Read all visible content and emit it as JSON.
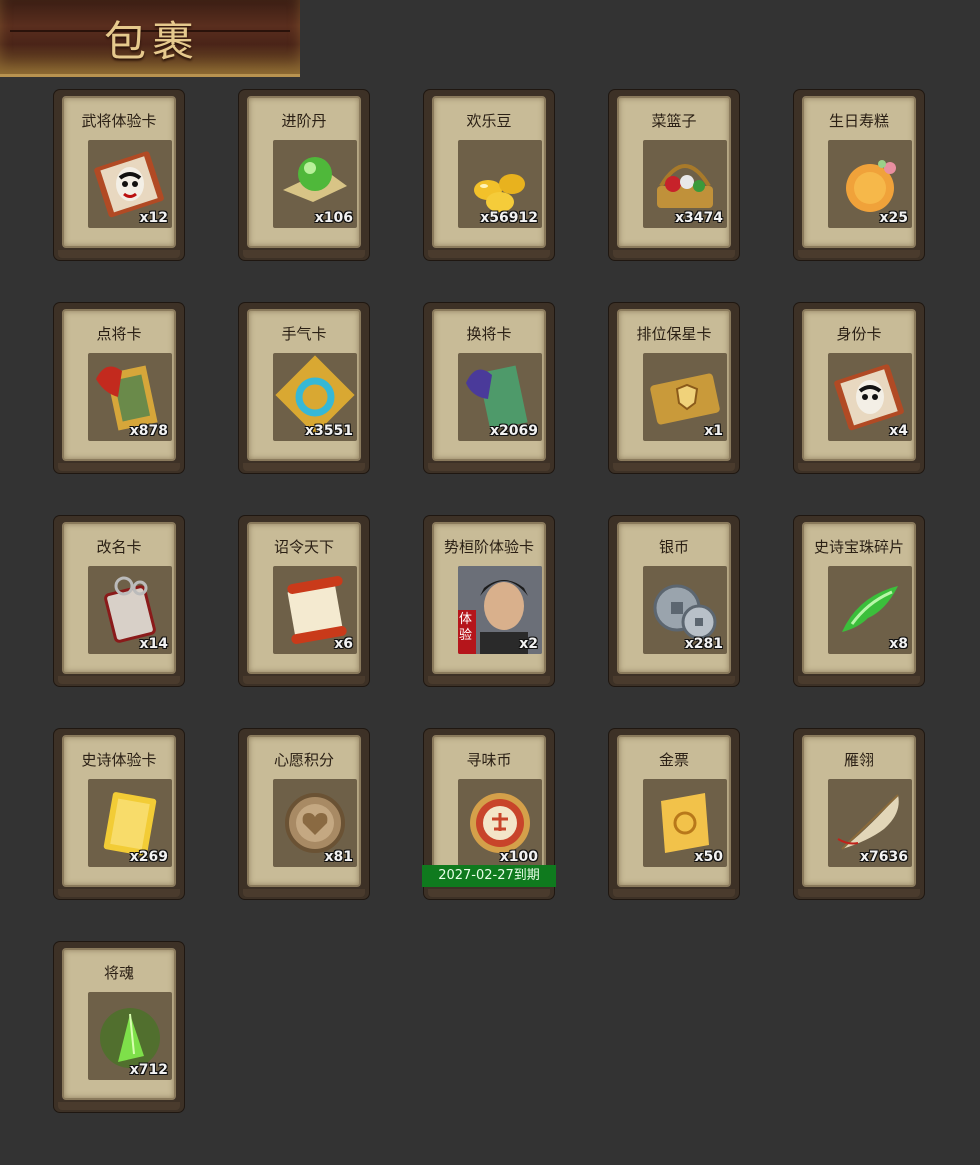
{
  "header": {
    "title": "包裹"
  },
  "items": [
    {
      "name": "武将体验卡",
      "qty": "x12",
      "icon": "opera-mask-card-icon"
    },
    {
      "name": "进阶丹",
      "qty": "x106",
      "icon": "green-pill-icon"
    },
    {
      "name": "欢乐豆",
      "qty": "x56912",
      "icon": "gold-beans-icon"
    },
    {
      "name": "菜篮子",
      "qty": "x3474",
      "icon": "basket-icon"
    },
    {
      "name": "生日寿糕",
      "qty": "x25",
      "icon": "birthday-cake-icon"
    },
    {
      "name": "点将卡",
      "qty": "x878",
      "icon": "general-card-icon"
    },
    {
      "name": "手气卡",
      "qty": "x3551",
      "icon": "luck-card-icon"
    },
    {
      "name": "换将卡",
      "qty": "x2069",
      "icon": "swap-card-icon"
    },
    {
      "name": "排位保星卡",
      "qty": "x1",
      "icon": "shield-ticket-icon"
    },
    {
      "name": "身份卡",
      "qty": "x4",
      "icon": "identity-card-icon"
    },
    {
      "name": "改名卡",
      "qty": "x14",
      "icon": "rename-card-icon"
    },
    {
      "name": "诏令天下",
      "qty": "x6",
      "icon": "scroll-icon"
    },
    {
      "name": "势桓阶体验卡",
      "qty": "x2",
      "icon": "hero-portrait-icon",
      "badge": "体验"
    },
    {
      "name": "银币",
      "qty": "x281",
      "icon": "silver-coin-icon"
    },
    {
      "name": "史诗宝珠碎片",
      "qty": "x8",
      "icon": "green-shard-icon"
    },
    {
      "name": "史诗体验卡",
      "qty": "x269",
      "icon": "gold-card-icon"
    },
    {
      "name": "心愿积分",
      "qty": "x81",
      "icon": "heart-coin-icon"
    },
    {
      "name": "寻味币",
      "qty": "x100",
      "icon": "taste-coin-icon",
      "expiry": "2027-02-27到期"
    },
    {
      "name": "金票",
      "qty": "x50",
      "icon": "gold-ticket-icon"
    },
    {
      "name": "雁翎",
      "qty": "x7636",
      "icon": "feather-icon"
    },
    {
      "name": "将魂",
      "qty": "x712",
      "icon": "green-crystal-icon"
    }
  ],
  "colors": {
    "background": "#333333",
    "card_face": "#c8bb97",
    "expiry_banner": "#0f7a1e"
  }
}
